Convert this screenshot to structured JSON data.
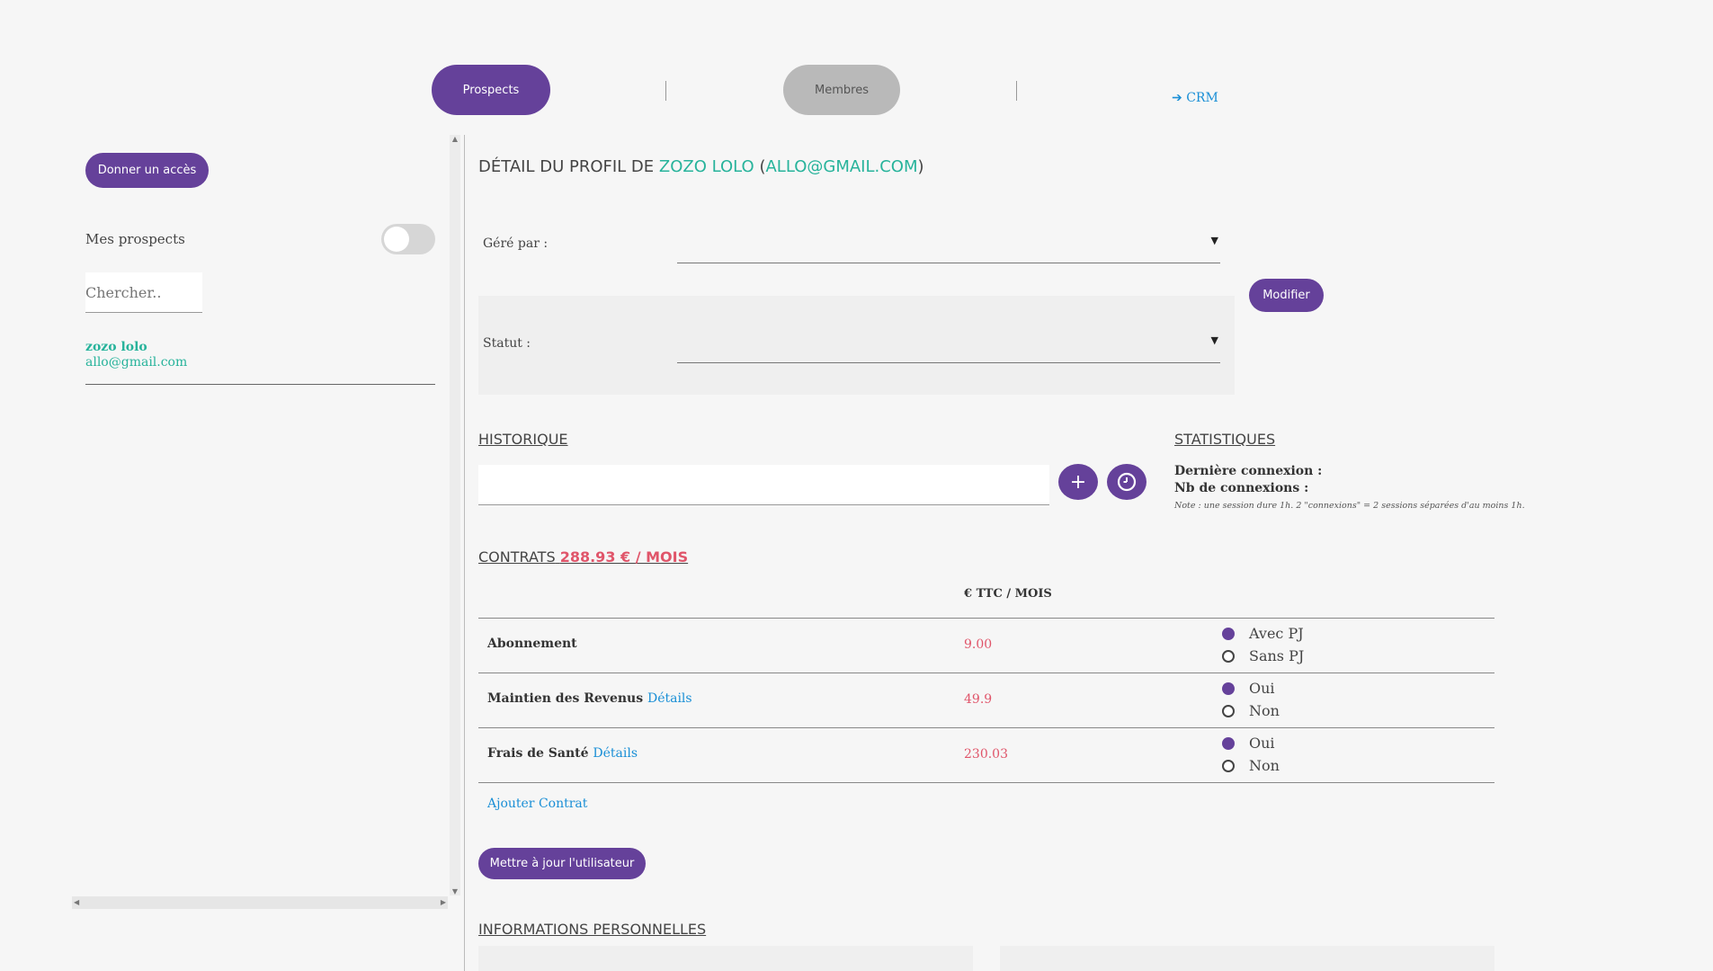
{
  "nav": {
    "prospects_label": "Prospects",
    "membres_label": "Membres",
    "crm_label": "CRM",
    "crm_icon": "arrow-right-icon"
  },
  "sidebar": {
    "give_access_label": "Donner un accès",
    "my_prospects_label": "Mes prospects",
    "my_prospects_on": false,
    "search_placeholder": "Chercher..",
    "prospects": [
      {
        "name": "zozo lolo",
        "email": "allo@gmail.com"
      }
    ]
  },
  "profile": {
    "title_prefix": "DÉTAIL DU PROFIL DE",
    "name": "ZOZO LOLO",
    "open_paren": "(",
    "email": "ALLO@GMAIL.COM",
    "close_paren": ")",
    "manager_label": "Géré par :",
    "status_label": "Statut :",
    "modify_label": "Modifier"
  },
  "historique": {
    "title": "HISTORIQUE",
    "add_label": "+",
    "clock_icon": "clock-icon"
  },
  "statistiques": {
    "title": "STATISTIQUES",
    "last_connection_label": "Dernière connexion :",
    "nb_connections_label": "Nb de connexions :",
    "note": "Note : une session dure 1h. 2 \"connexions\" = 2 sessions séparées d'au moins 1h."
  },
  "contrats": {
    "title": "CONTRATS",
    "total": "288.93 € / MOIS",
    "column_header": "€ TTC / MOIS",
    "rows": [
      {
        "label": "Abonnement",
        "details": "",
        "value": "9.00",
        "options": [
          "Avec PJ",
          "Sans PJ"
        ],
        "selected": 0
      },
      {
        "label": "Maintien des Revenus",
        "details": "Détails",
        "value": "49.9",
        "options": [
          "Oui",
          "Non"
        ],
        "selected": 0
      },
      {
        "label": "Frais de Santé",
        "details": "Détails",
        "value": "230.03",
        "options": [
          "Oui",
          "Non"
        ],
        "selected": 0
      }
    ],
    "add_contract_label": "Ajouter Contrat",
    "update_user_label": "Mettre à jour l'utilisateur"
  },
  "infos": {
    "title": "INFORMATIONS PERSONNELLES"
  },
  "colors": {
    "purple": "#65419a",
    "teal": "#27b39b",
    "red": "#e0556a",
    "link": "#1a8fd6"
  }
}
